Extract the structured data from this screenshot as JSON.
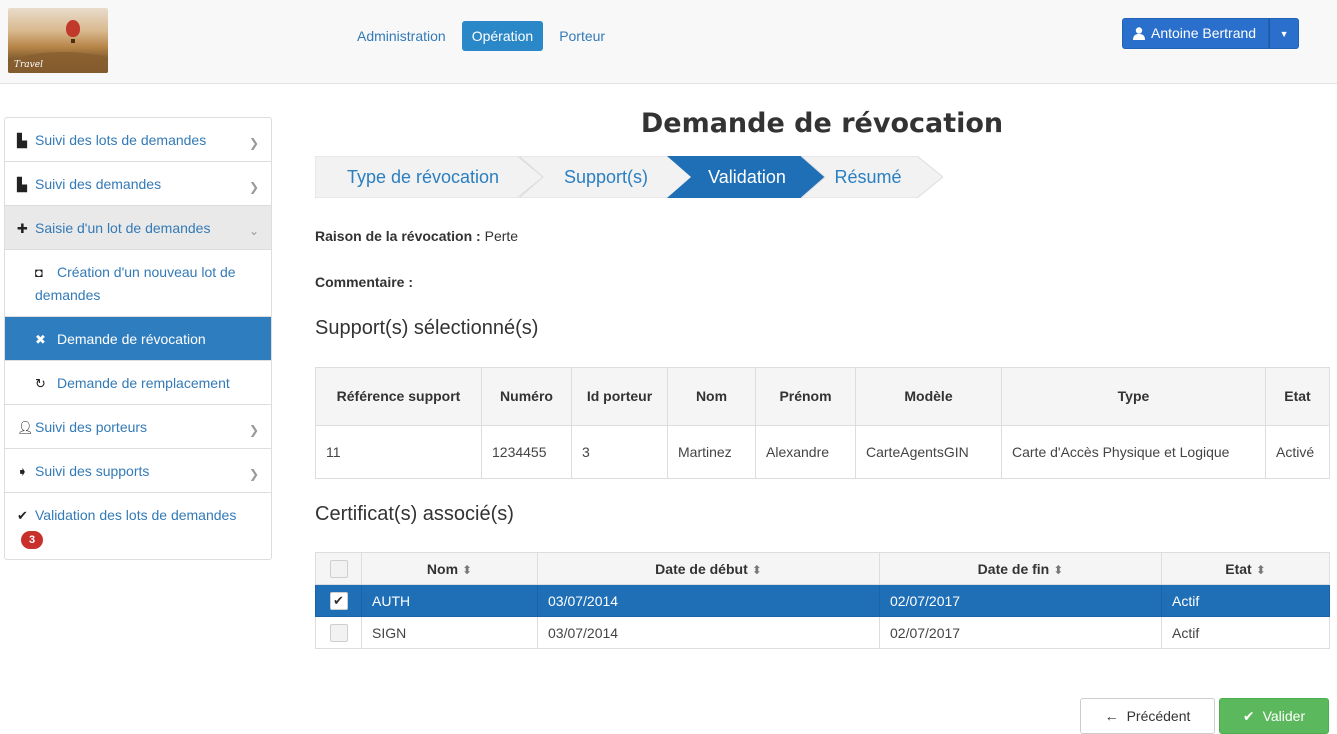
{
  "logo": {
    "text": "Travel"
  },
  "topnav": [
    {
      "label": "Administration",
      "active": false
    },
    {
      "label": "Opération",
      "active": true
    },
    {
      "label": "Porteur",
      "active": false
    }
  ],
  "user": {
    "name": "Antoine Bertrand"
  },
  "sidebar": {
    "items": [
      {
        "label": "Suivi des lots de demandes",
        "icon": "file-icon"
      },
      {
        "label": "Suivi des demandes",
        "icon": "file-icon"
      },
      {
        "label": "Saisie d'un lot de demandes",
        "icon": "plus-icon",
        "open": true
      },
      {
        "label": "Création d'un nouveau lot de demandes",
        "icon": "inbox-icon"
      },
      {
        "label": "Demande de révocation",
        "icon": "times-icon",
        "active": true
      },
      {
        "label": "Demande de remplacement",
        "icon": "refresh-icon"
      },
      {
        "label": "Suivi des porteurs",
        "icon": "user-icon"
      },
      {
        "label": "Suivi des supports",
        "icon": "tags-icon"
      },
      {
        "label": "Validation des lots de demandes",
        "icon": "check-icon",
        "badge": "3"
      }
    ]
  },
  "page": {
    "title": "Demande de révocation"
  },
  "wizard": {
    "steps": [
      {
        "label": "Type de révocation",
        "active": false
      },
      {
        "label": "Support(s)",
        "active": false
      },
      {
        "label": "Validation",
        "active": true
      },
      {
        "label": "Résumé",
        "active": false
      }
    ]
  },
  "fields": {
    "reason_label": "Raison de la révocation :",
    "reason_value": "Perte",
    "comment_label": "Commentaire :"
  },
  "supports": {
    "title": "Support(s) sélectionné(s)",
    "headers": [
      "Référence support",
      "Numéro",
      "Id porteur",
      "Nom",
      "Prénom",
      "Modèle",
      "Type",
      "Etat"
    ],
    "rows": [
      [
        "11",
        "1234455",
        "3",
        "Martinez",
        "Alexandre",
        "CarteAgentsGIN",
        "Carte d'Accès Physique et Logique",
        "Activé"
      ]
    ]
  },
  "certificates": {
    "title": "Certificat(s) associé(s)",
    "headers": [
      "Nom",
      "Date de début",
      "Date de fin",
      "Etat"
    ],
    "rows": [
      {
        "checked": true,
        "cells": [
          "AUTH",
          "03/07/2014",
          "02/07/2017",
          "Actif"
        ]
      },
      {
        "checked": false,
        "cells": [
          "SIGN",
          "03/07/2014",
          "02/07/2017",
          "Actif"
        ]
      }
    ]
  },
  "buttons": {
    "previous": "Précédent",
    "validate": "Valider"
  },
  "colors": {
    "accent": "#2a88c8",
    "selected_row": "#1f6fb7",
    "success": "#5cb85c",
    "badge": "#c9302c"
  }
}
